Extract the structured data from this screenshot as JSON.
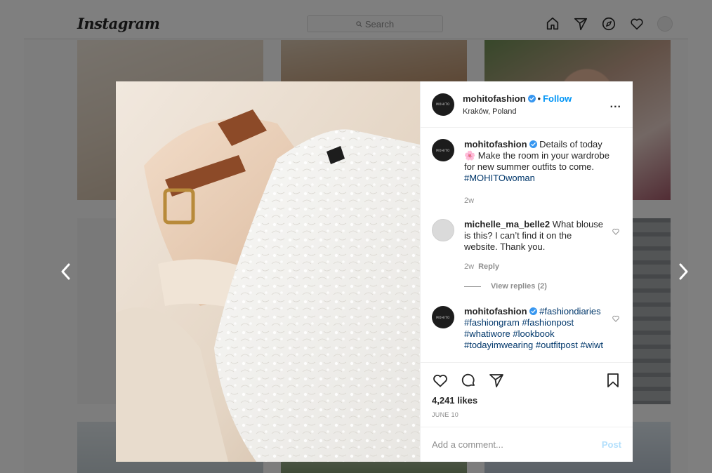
{
  "topnav": {
    "logo": "Instagram",
    "search_placeholder": "Search",
    "icons": [
      "home-icon",
      "direct-icon",
      "explore-icon",
      "activity-heart-icon",
      "profile-avatar"
    ]
  },
  "navigation": {
    "prev": "chevron-left-icon",
    "next": "chevron-right-icon"
  },
  "post": {
    "author": "mohitofashion",
    "verified": true,
    "follow_label": "Follow",
    "separator": "•",
    "location": "Kraków, Poland",
    "more_label": "...",
    "avatar_text": "MOHITO",
    "caption": {
      "username": "mohitofashion",
      "text": "Details of today 🌸 Make the room in your wardrobe for new summer outfits to come.",
      "hashtag": "#MOHITOwoman",
      "time": "2w"
    },
    "comments": [
      {
        "username": "michelle_ma_belle2",
        "text": "What blouse is this? I can’t find it on the website. Thank you.",
        "time": "2w",
        "reply_label": "Reply",
        "view_replies": "View replies (2)"
      },
      {
        "username": "mohitofashion",
        "hashtags": "#fashiondiaries #fashiongram #fashionpost #whatiwore #lookbook #todayimwearing #outfitpost #wiwt"
      }
    ],
    "likes": "4,241 likes",
    "date": "JUNE 10",
    "comment_placeholder": "Add a comment...",
    "post_label": "Post"
  },
  "colors": {
    "link_blue": "#0095f6",
    "hashtag": "#00376b",
    "muted": "#8e8e8e",
    "post_disabled": "#b2dffc"
  }
}
